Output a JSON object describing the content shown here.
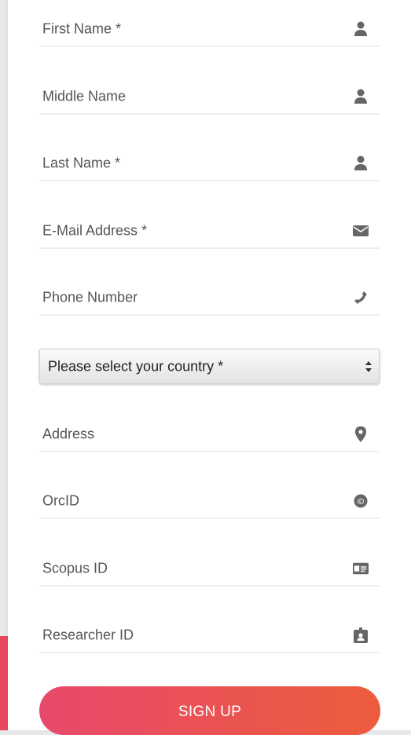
{
  "form": {
    "fields": [
      {
        "label": "First Name *",
        "icon": "user-icon"
      },
      {
        "label": "Middle Name",
        "icon": "user-icon"
      },
      {
        "label": "Last Name *",
        "icon": "user-icon"
      },
      {
        "label": "E-Mail Address *",
        "icon": "envelope-icon"
      },
      {
        "label": "Phone Number",
        "icon": "phone-icon"
      },
      {
        "label": "Address",
        "icon": "map-marker-icon"
      },
      {
        "label": "OrcID",
        "icon": "orcid-icon"
      },
      {
        "label": "Scopus ID",
        "icon": "id-card-icon"
      },
      {
        "label": "Researcher ID",
        "icon": "id-badge-icon"
      }
    ],
    "country_select": {
      "value": "Please select your country *"
    },
    "submit_label": "SIGN UP"
  },
  "colors": {
    "icon": "#666666",
    "underline": "#eeeeee",
    "button_start": "#e8496c",
    "button_end": "#ec5c3c",
    "accent": "#e8495d"
  }
}
